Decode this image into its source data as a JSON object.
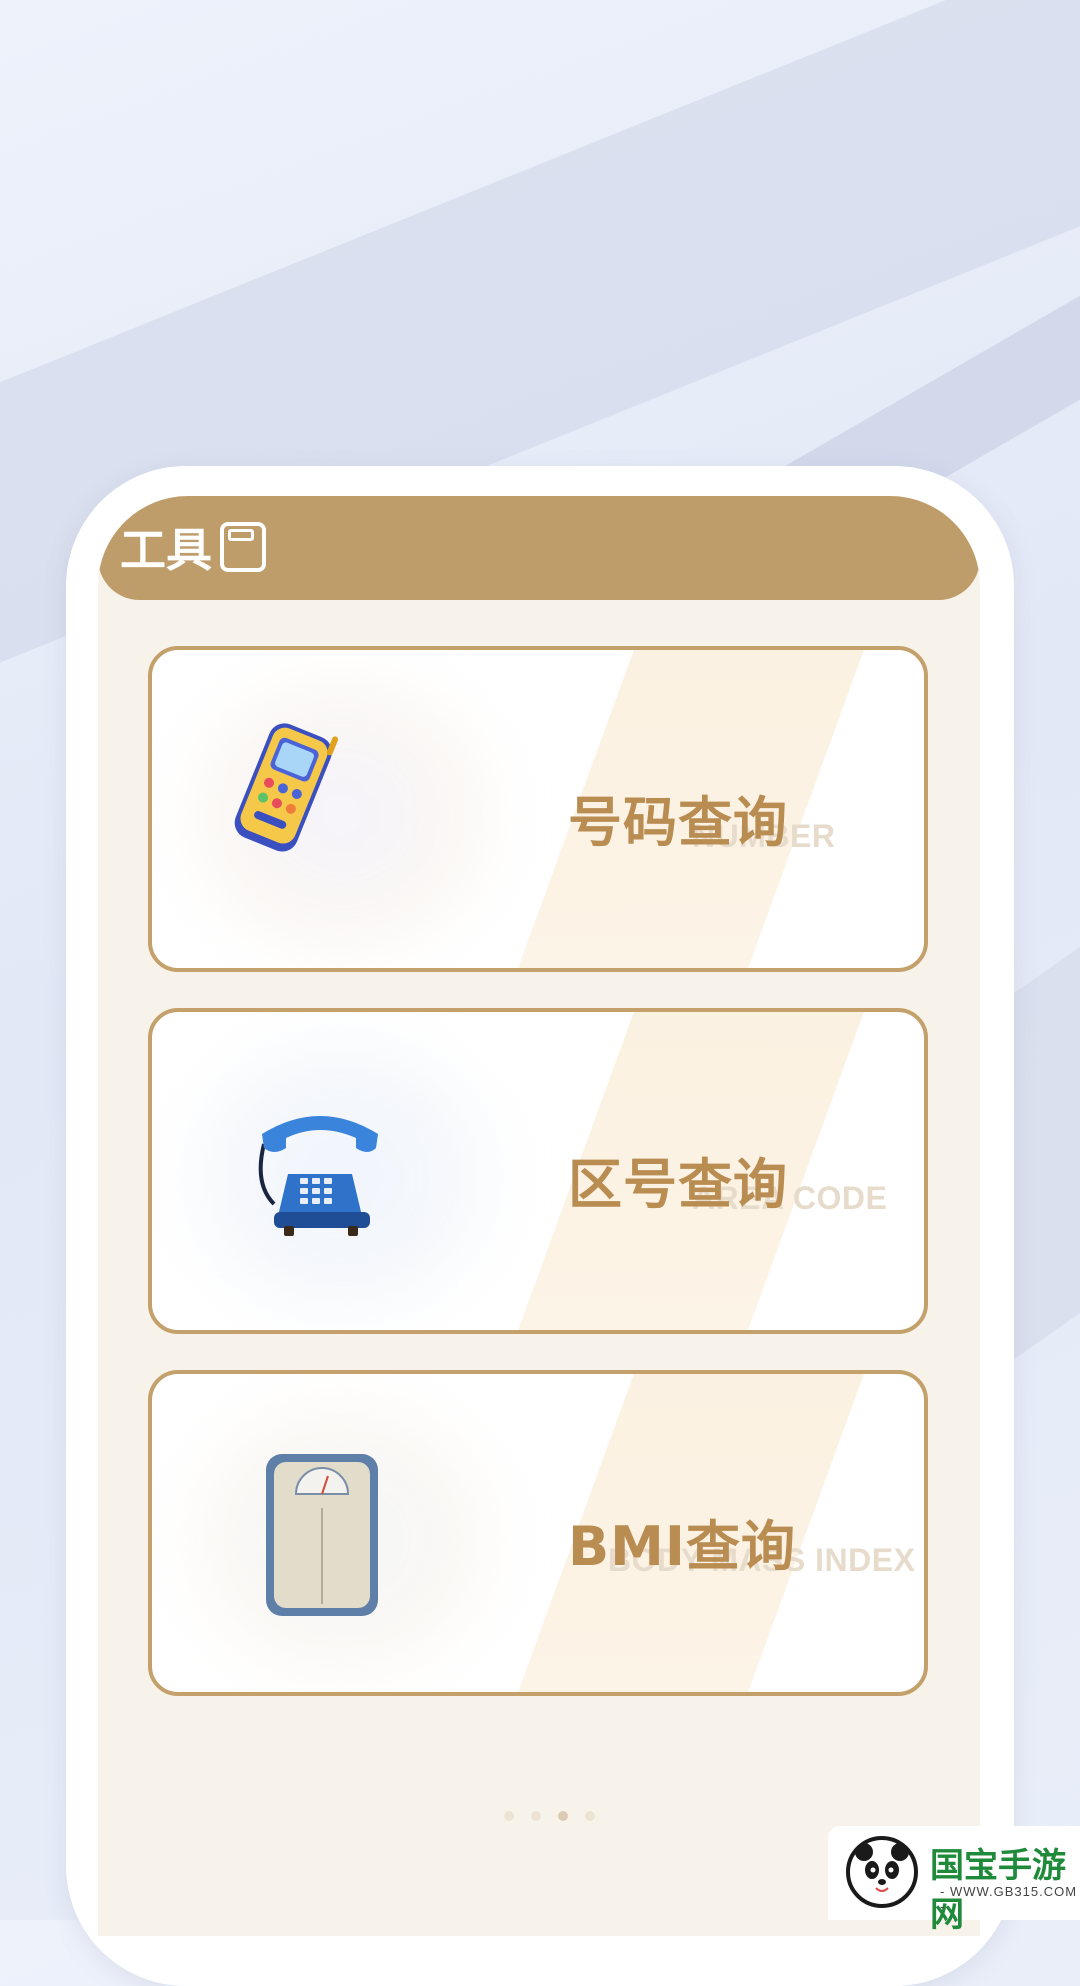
{
  "header": {
    "title": "工具",
    "title_icon": "save-icon",
    "bar_color": "#bf9d6a"
  },
  "cards": [
    {
      "title": "号码查询",
      "subtitle": "NUMBER",
      "icon": "cellphone-icon"
    },
    {
      "title": "区号查询",
      "subtitle": "AREA CODE",
      "icon": "rotary-telephone-icon"
    },
    {
      "title": "BMI查询",
      "subtitle": "BODY MASS INDEX",
      "icon": "weight-scale-icon"
    }
  ],
  "pager": {
    "pages": 4,
    "active": 3
  },
  "watermark": {
    "brand": "国宝手游网",
    "url": "- WWW.GB315.COM -",
    "icon": "panda-logo-icon"
  },
  "colors": {
    "accent": "#bf9d6a",
    "card_border": "#c4a06a",
    "card_title": "#b98c52",
    "screen_bg": "#f8f3ea"
  }
}
